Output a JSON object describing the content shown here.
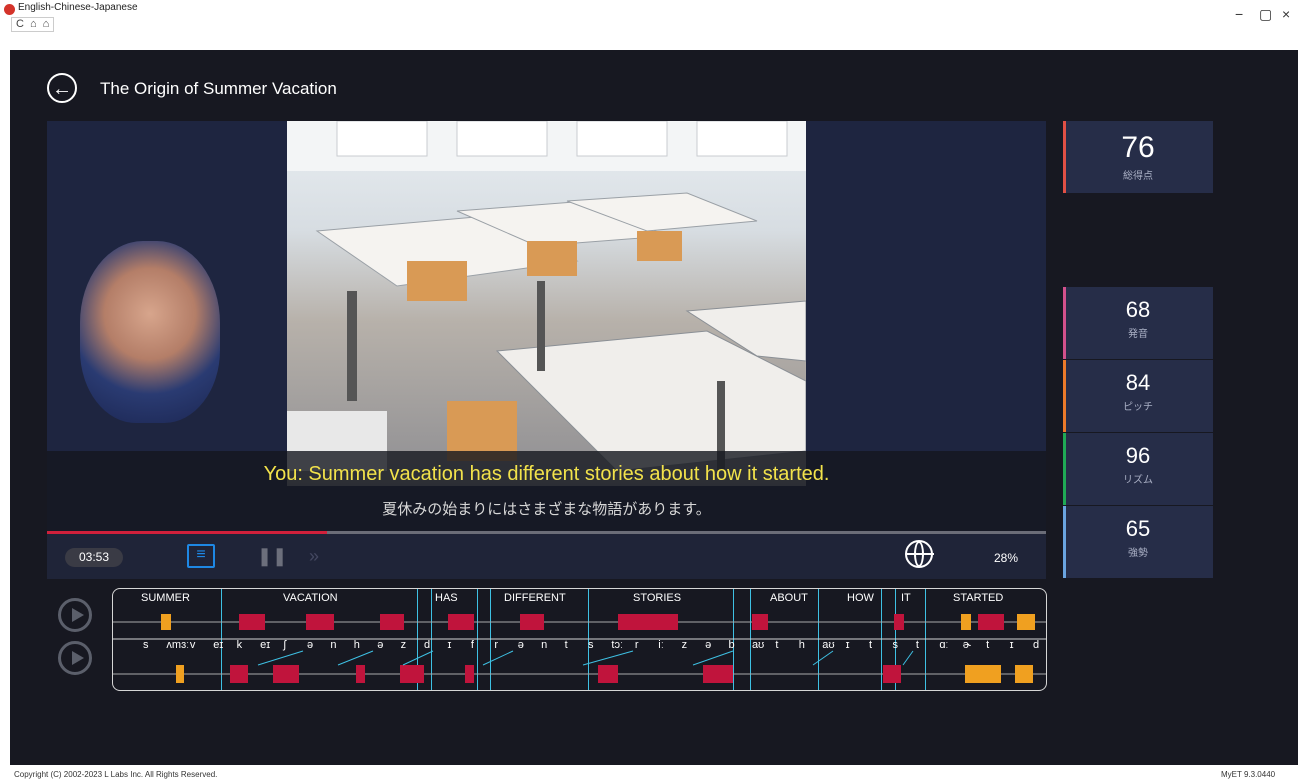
{
  "window": {
    "title": "English-Chinese-Japanese",
    "nav_icons": [
      "C",
      "⌂",
      "⌂"
    ],
    "controls": {
      "minimize": "−",
      "maximize": "▢",
      "close": "×"
    }
  },
  "lesson": {
    "title": "The Origin of Summer Vacation",
    "back_icon": "back-arrow-icon"
  },
  "subtitles": {
    "english": "You: Summer vacation has different stories about how it started.",
    "japanese": "夏休みの始まりにはさまざまな物語があります。"
  },
  "player": {
    "time": "03:53",
    "progress": 0.28,
    "percent": "28%"
  },
  "scores": [
    {
      "key": "total",
      "value": "76",
      "label": "総得点",
      "color": "#e05045"
    },
    {
      "key": "pronunciation",
      "value": "68",
      "label": "発音",
      "color": "#d2518c"
    },
    {
      "key": "pitch",
      "value": "84",
      "label": "ピッチ",
      "color": "#ec7a2a"
    },
    {
      "key": "rhythm",
      "value": "96",
      "label": "リズム",
      "color": "#1faa55"
    },
    {
      "key": "intensity",
      "value": "65",
      "label": "強勢",
      "color": "#6aa4e0"
    }
  ],
  "waveform": {
    "words": [
      "SUMMER",
      "VACATION",
      "HAS",
      "DIFFERENT",
      "STORIES",
      "ABOUT",
      "HOW",
      "IT",
      "STARTED"
    ],
    "phonemes": [
      "s",
      "ʌmɜː",
      "v",
      "eɪ",
      "k",
      "eɪ",
      "ʃ",
      "ə",
      "n",
      "h",
      "ə",
      "z",
      "d",
      "ɪ",
      "f",
      "r",
      "ə",
      "n",
      "t",
      "s",
      "tɔː",
      "r",
      "iː",
      "z",
      "ə",
      "b",
      "aʊ",
      "t",
      "h",
      "aʊ",
      "ɪ",
      "t",
      "s",
      "t",
      "ɑː",
      "ɚ",
      "t",
      "ɪ",
      "d"
    ]
  },
  "footer": {
    "copyright": "Copyright (C) 2002-2023 L Labs Inc. All Rights Reserved.",
    "version": "MyET 9.3.0440"
  }
}
